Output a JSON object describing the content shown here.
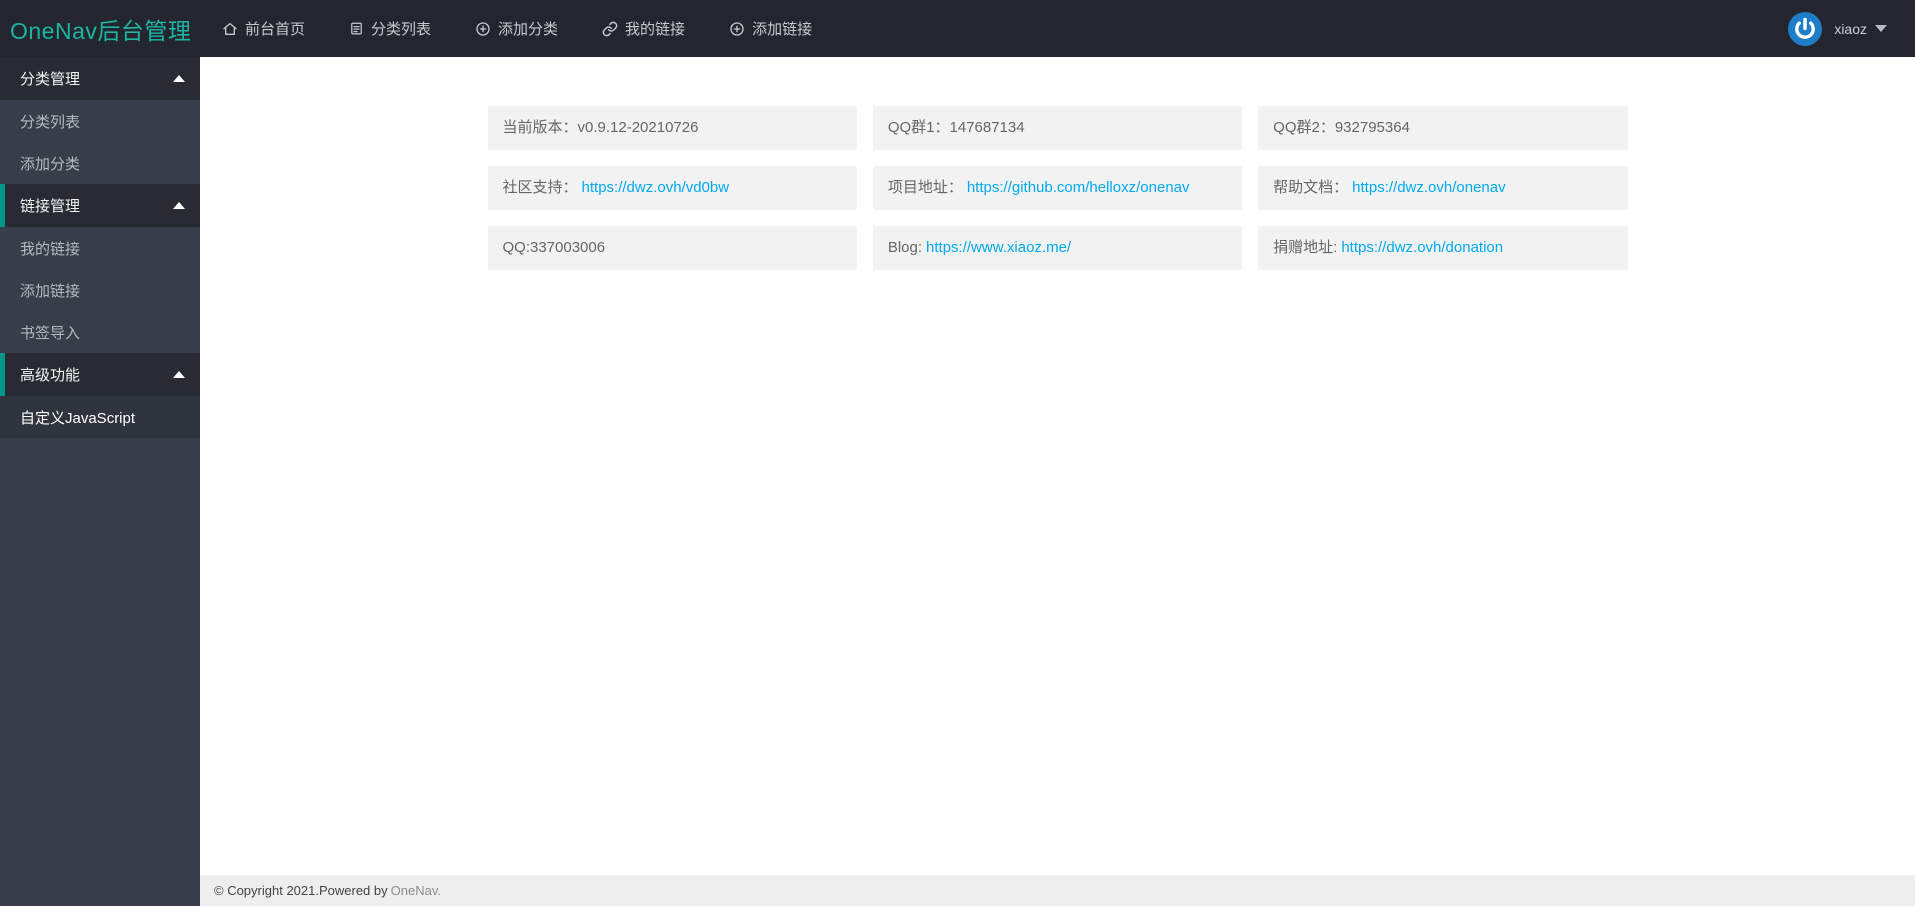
{
  "header": {
    "logo": "OneNav后台管理",
    "nav": [
      {
        "icon": "home-icon",
        "label": "前台首页"
      },
      {
        "icon": "doc-list-icon",
        "label": "分类列表"
      },
      {
        "icon": "add-circle-icon",
        "label": "添加分类"
      },
      {
        "icon": "link-icon",
        "label": "我的链接"
      },
      {
        "icon": "add-circle-icon",
        "label": "添加链接"
      }
    ],
    "user": {
      "name": "xiaoz"
    }
  },
  "sidebar": {
    "groups": [
      {
        "label": "分类管理",
        "items": [
          {
            "label": "分类列表"
          },
          {
            "label": "添加分类"
          }
        ]
      },
      {
        "label": "链接管理",
        "items": [
          {
            "label": "我的链接"
          },
          {
            "label": "添加链接"
          },
          {
            "label": "书签导入"
          }
        ]
      },
      {
        "label": "高级功能",
        "items": [
          {
            "label": "自定义JavaScript"
          }
        ]
      }
    ]
  },
  "cards": [
    {
      "label": "当前版本：v0.9.12-20210726"
    },
    {
      "label": "QQ群1：147687134"
    },
    {
      "label": "QQ群2：932795364"
    },
    {
      "label": "社区支持：",
      "link": "https://dwz.ovh/vd0bw"
    },
    {
      "label": "项目地址：",
      "link": "https://github.com/helloxz/onenav"
    },
    {
      "label": "帮助文档：",
      "link": "https://dwz.ovh/onenav"
    },
    {
      "label": "QQ:337003006"
    },
    {
      "label": "Blog:",
      "link": "https://www.xiaoz.me/"
    },
    {
      "label": "捐赠地址:",
      "link": "https://dwz.ovh/donation"
    }
  ],
  "footer": {
    "text": "© Copyright 2021.Powered by ",
    "link_label": "OneNav."
  },
  "colors": {
    "header_bg": "#23262e",
    "sidebar_bg": "#393d49",
    "logo_teal": "#1cb5a3",
    "accent_teal": "#009688",
    "link_blue": "#01aaed",
    "avatar_blue": "#1d7ec7",
    "card_bg": "#f2f2f2"
  }
}
